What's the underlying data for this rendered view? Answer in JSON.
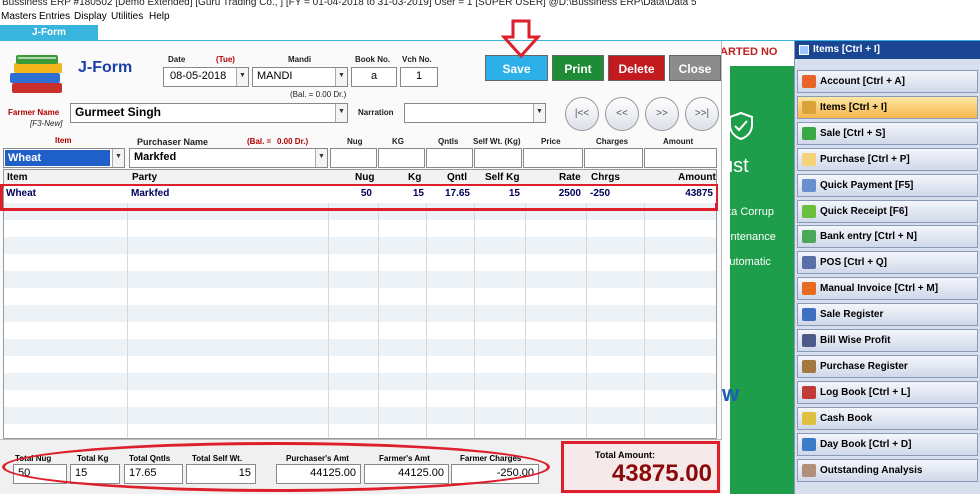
{
  "window": {
    "title": "Bussiness ERP #180502  [Demo Extended]  [Guru Trading Co., ] [FY = 01-04-2018 to 31-03-2019] User = 1 [SUPER USER]  @D:\\Bussiness ERP\\Data\\Data 5"
  },
  "menu": [
    "Masters",
    "Entries",
    "Display",
    "Utilities",
    "Help"
  ],
  "tab": "J-Form",
  "form": {
    "title": "J-Form",
    "date_label": "Date",
    "day": "(Tue)",
    "date": "08-05-2018",
    "mandi_label": "Mandi",
    "mandi": "MANDI",
    "mandi_bal": "(Bal. = 0.00 Dr.)",
    "bookno_label": "Book No.",
    "bookno": "a",
    "vchno_label": "Vch No.",
    "vchno": "1",
    "farmer_label": "Farmer Name",
    "farmer_hint": "[F3-New]",
    "farmer": "Gurmeet Singh",
    "narration_label": "Narration",
    "narration": ""
  },
  "buttons": {
    "save": "Save",
    "print": "Print",
    "delete": "Delete",
    "close": "Close"
  },
  "nav": [
    "|<<",
    "<<",
    ">>",
    ">>|"
  ],
  "entry": {
    "labels": {
      "item": "Item",
      "purchaser": "Purchaser Name",
      "bal": "(Bal. =",
      "bal_value": "0.00 Dr.)",
      "nug": "Nug",
      "kg": "KG",
      "qntls": "Qntls",
      "selfwt": "Self Wt. (Kg)",
      "price": "Price",
      "charges": "Charges",
      "amount": "Amount"
    },
    "item": "Wheat",
    "purchaser": "Markfed"
  },
  "grid": {
    "headers": {
      "item": "Item",
      "party": "Party",
      "nug": "Nug",
      "kg": "Kg",
      "qntl": "Qntl",
      "selfkg": "Self Kg",
      "rate": "Rate",
      "chrgs": "Chrgs",
      "amount": "Amount"
    },
    "rows": [
      {
        "item": "Wheat",
        "party": "Markfed",
        "nug": "50",
        "kg": "15",
        "qntl": "17.65",
        "selfkg": "15",
        "rate": "2500",
        "chrgs": "-250",
        "amount": "43875"
      }
    ]
  },
  "totals": {
    "nug_label": "Total Nug",
    "nug": "50",
    "kg_label": "Total Kg",
    "kg": "15",
    "qntls_label": "Total Qntls",
    "qntls": "17.65",
    "selfwt_label": "Total Self Wt.",
    "selfwt": "15",
    "purch_label": "Purchaser's Amt",
    "purch": "44125.00",
    "farmer_label": "Farmer's Amt",
    "farmer": "44125.00",
    "charges_label": "Farmer Charges",
    "charges": "-250.00",
    "amount_label": "Total Amount:",
    "amount": "43875.00"
  },
  "ad": {
    "banner": "ARTED NO",
    "line1": "ust",
    "line2": "ata Corrup",
    "line3": "aintenance",
    "line4": "Automatic",
    "line5": "w"
  },
  "sidebar": {
    "header": "Items [Ctrl + I]",
    "items": [
      {
        "label": "Account [Ctrl + A]",
        "color": "#e8642a"
      },
      {
        "label": "Items [Ctrl + I]",
        "color": "#d9a33a"
      },
      {
        "label": "Sale [Ctrl + S]",
        "color": "#3aa845"
      },
      {
        "label": "Purchase [Ctrl + P]",
        "color": "#f3d27a"
      },
      {
        "label": "Quick Payment [F5]",
        "color": "#6a8fd0"
      },
      {
        "label": "Quick Receipt [F6]",
        "color": "#6cbf3a"
      },
      {
        "label": "Bank entry [Ctrl + N]",
        "color": "#4aa858"
      },
      {
        "label": "POS [Ctrl + Q]",
        "color": "#5a6ea8"
      },
      {
        "label": "Manual Invoice [Ctrl + M]",
        "color": "#e66a1f"
      },
      {
        "label": "Sale Register",
        "color": "#3f6fc2"
      },
      {
        "label": "Bill Wise Profit",
        "color": "#4d5a8a"
      },
      {
        "label": "Purchase Register",
        "color": "#a57840"
      },
      {
        "label": "Log Book [Ctrl + L]",
        "color": "#c23b3b"
      },
      {
        "label": "Cash Book",
        "color": "#e0c040"
      },
      {
        "label": "Day Book [Ctrl + D]",
        "color": "#3b7bc8"
      },
      {
        "label": "Outstanding Analysis",
        "color": "#b0907a"
      }
    ]
  }
}
